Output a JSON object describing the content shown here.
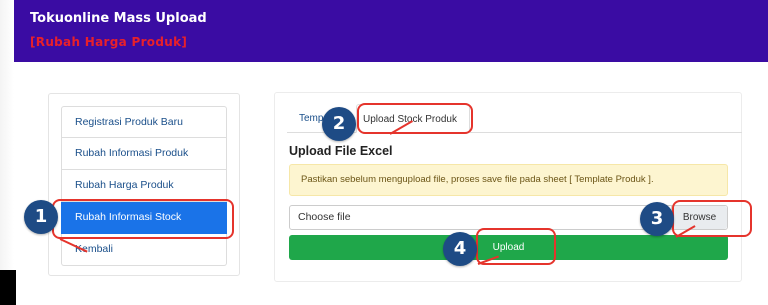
{
  "header": {
    "title": "Tokuonline Mass Upload",
    "subtitle": "[Rubah Harga Produk]",
    "bg_color": "#3a0ca3",
    "subtitle_color": "#e8202a"
  },
  "sidebar": {
    "items": [
      {
        "label": "Registrasi Produk Baru"
      },
      {
        "label": "Rubah Informasi Produk"
      },
      {
        "label": "Rubah Harga Produk"
      },
      {
        "label": "Rubah Informasi Stock",
        "active": true
      },
      {
        "label": "Kembali"
      }
    ],
    "active_color": "#1a73e8"
  },
  "tabs": [
    {
      "label": "Temp"
    },
    {
      "label": "Upload Stock Produk",
      "active": true
    }
  ],
  "upload": {
    "title": "Upload File Excel",
    "alert": "Pastikan sebelum mengupload file, proses save file pada sheet [ Template Produk ].",
    "file_label": "Choose file",
    "browse_label": "Browse",
    "upload_label": "Upload",
    "upload_color": "#1fa74a"
  },
  "annotations": {
    "badges": [
      "1",
      "2",
      "3",
      "4"
    ],
    "badge_color": "#1e4b85",
    "callout_color": "#e5342c"
  }
}
